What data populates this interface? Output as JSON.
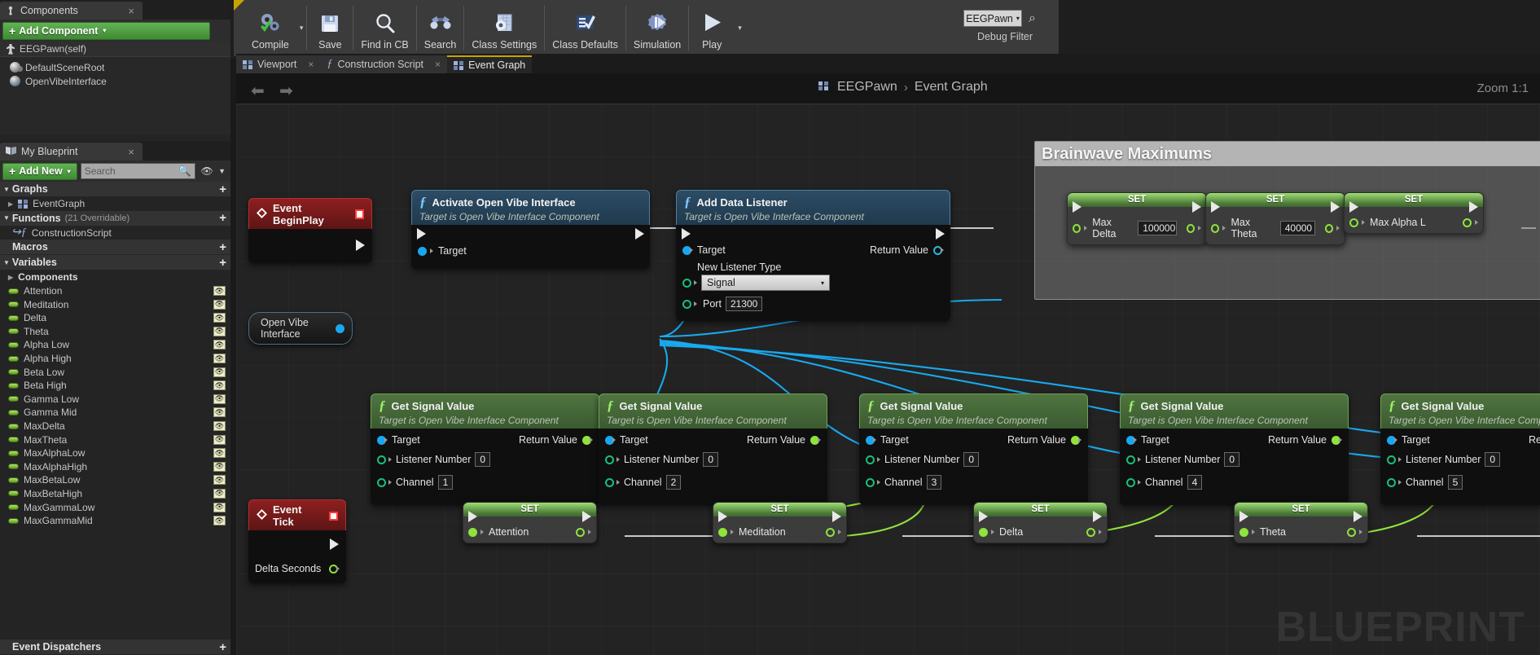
{
  "components_panel": {
    "tab_label": "Components",
    "tab_icon": "components-icon",
    "close": "×",
    "add_component_label": "Add Component",
    "add_component_caret": "▾",
    "root_item": "EEGPawn(self)",
    "items": [
      "DefaultSceneRoot",
      "OpenVibeInterface"
    ]
  },
  "my_blueprint_panel": {
    "tab_label": "My Blueprint",
    "close": "×",
    "add_new_label": "Add New",
    "add_new_caret": "▾",
    "search_placeholder": "Search",
    "sections": {
      "graphs": {
        "label": "Graphs",
        "plus": "+",
        "items": [
          "EventGraph"
        ]
      },
      "functions": {
        "label": "Functions",
        "sub": "(21 Overridable)",
        "plus": "+",
        "items": [
          "ConstructionScript"
        ]
      },
      "macros": {
        "label": "Macros",
        "plus": "+"
      },
      "variables": {
        "label": "Variables",
        "plus": "+",
        "components_group": "Components",
        "items": [
          "Attention",
          "Meditation",
          "Delta",
          "Theta",
          "Alpha Low",
          "Alpha High",
          "Beta Low",
          "Beta High",
          "Gamma Low",
          "Gamma Mid",
          "MaxDelta",
          "MaxTheta",
          "MaxAlphaLow",
          "MaxAlphaHigh",
          "MaxBetaLow",
          "MaxBetaHigh",
          "MaxGammaLow",
          "MaxGammaMid"
        ]
      },
      "event_dispatchers": {
        "label": "Event Dispatchers",
        "plus": "+"
      }
    }
  },
  "toolbar": {
    "items": [
      {
        "label": "Compile",
        "icon": "compile-icon",
        "has_dropdown": true
      },
      {
        "label": "Save",
        "icon": "save-icon"
      },
      {
        "label": "Find in CB",
        "icon": "find-in-cb-icon"
      },
      {
        "label": "Search",
        "icon": "search-icon"
      },
      {
        "label": "Class Settings",
        "icon": "class-settings-icon"
      },
      {
        "label": "Class Defaults",
        "icon": "class-defaults-icon"
      },
      {
        "label": "Simulation",
        "icon": "simulation-icon"
      },
      {
        "label": "Play",
        "icon": "play-icon",
        "has_dropdown": true
      }
    ],
    "debug_filter": {
      "value": "EEGPawn",
      "caret": "▾",
      "label": "Debug Filter",
      "search_icon": "magnifier-icon"
    }
  },
  "graph_tabs": [
    {
      "label": "Viewport",
      "icon": "viewport-icon",
      "active": false,
      "close": "×"
    },
    {
      "label": "Construction Script",
      "icon": "function-icon",
      "active": false,
      "close": "×"
    },
    {
      "label": "Event Graph",
      "icon": "graph-icon",
      "active": true,
      "close": "×"
    }
  ],
  "graph_header": {
    "back_icon": "back-arrow-icon",
    "forward_icon": "forward-arrow-icon",
    "breadcrumb": [
      "EEGPawn",
      "Event Graph"
    ],
    "breadcrumb_separator": "›",
    "zoom": "Zoom 1:1"
  },
  "watermark": "BLUEPRINT",
  "nodes": {
    "event_begin_play": {
      "title": "Event BeginPlay",
      "icon": "event-node-icon"
    },
    "event_tick": {
      "title": "Event Tick",
      "icon": "event-node-icon",
      "output_pin": "Delta Seconds"
    },
    "open_vibe_interface_pill": {
      "label": "Open Vibe Interface"
    },
    "activate_open_vibe": {
      "title": "Activate Open Vibe Interface",
      "subtitle": "Target is Open Vibe Interface Component",
      "target_pin": "Target"
    },
    "add_data_listener": {
      "title": "Add Data Listener",
      "subtitle": "Target is Open Vibe Interface Component",
      "target_pin": "Target",
      "return_pin": "Return Value",
      "listener_type_label": "New Listener Type",
      "listener_type_value": "Signal",
      "listener_type_caret": "▾",
      "port_label": "Port",
      "port_value": "21300"
    },
    "get_signal_value": {
      "title": "Get Signal Value",
      "subtitle": "Target is Open Vibe Interface Component",
      "target_pin": "Target",
      "return_pin": "Return Value",
      "listener_label": "Listener Number",
      "channel_label": "Channel",
      "instances": [
        {
          "listener": "0",
          "channel": "1"
        },
        {
          "listener": "0",
          "channel": "2"
        },
        {
          "listener": "0",
          "channel": "3"
        },
        {
          "listener": "0",
          "channel": "4"
        },
        {
          "listener": "0",
          "channel": "5"
        }
      ]
    },
    "comment": {
      "title": "Brainwave Maximums"
    },
    "set_nodes_top": {
      "header": "SET",
      "items": [
        {
          "var": "Max Delta",
          "value": "100000"
        },
        {
          "var": "Max Theta",
          "value": "40000"
        },
        {
          "var": "Max Alpha L",
          "value": ""
        }
      ]
    },
    "set_nodes_bottom": {
      "header": "SET",
      "items": [
        {
          "var": "Attention"
        },
        {
          "var": "Meditation"
        },
        {
          "var": "Delta"
        },
        {
          "var": "Theta"
        }
      ]
    }
  },
  "colors": {
    "accent_green": "#4e9a3a",
    "exec_wire": "#c8c8c8",
    "data_wire_blue": "#19a9ee",
    "data_wire_green": "#8fe33c",
    "tab_highlight": "#c8a400"
  }
}
